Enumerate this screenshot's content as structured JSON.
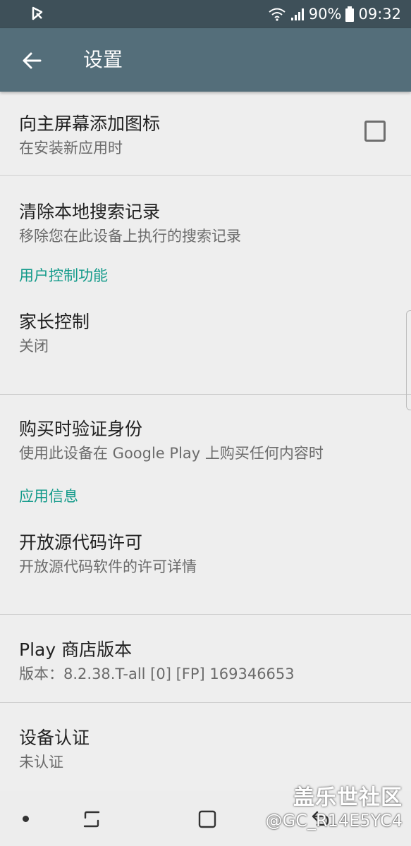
{
  "status_bar": {
    "battery_percent": "90%",
    "time": "09:32"
  },
  "app_bar": {
    "title": "设置"
  },
  "items": {
    "add_icon": {
      "title": "向主屏幕添加图标",
      "subtitle": "在安装新应用时",
      "checked": false
    },
    "clear_history": {
      "title": "清除本地搜索记录",
      "subtitle": "移除您在此设备上执行的搜索记录"
    },
    "parental": {
      "title": "家长控制",
      "subtitle": "关闭"
    },
    "purchase_auth": {
      "title": "购买时验证身份",
      "subtitle": "使用此设备在 Google Play 上购买任何内容时"
    },
    "open_source": {
      "title": "开放源代码许可",
      "subtitle": "开放源代码软件的许可详情"
    },
    "play_version": {
      "title": "Play 商店版本",
      "subtitle": "版本：8.2.38.T-all [0] [FP] 169346653"
    },
    "device_cert": {
      "title": "设备认证",
      "subtitle": "未认证"
    }
  },
  "sections": {
    "user_controls": "用户控制功能",
    "app_info": "应用信息"
  },
  "watermark": {
    "text": "盖乐世社区",
    "handle": "@GC_R14E5YC4"
  },
  "colors": {
    "status_bar": "#3e5059",
    "app_bar": "#546e7a",
    "accent": "#129a8a",
    "background": "#eeeeee"
  }
}
